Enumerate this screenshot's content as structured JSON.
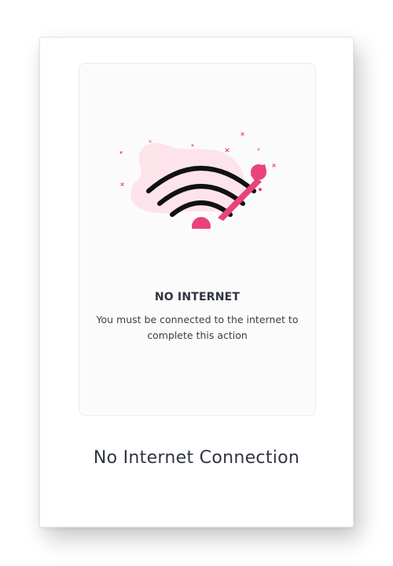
{
  "panel": {
    "heading": "NO INTERNET",
    "message": "You must be connected to the internet to complete this action"
  },
  "caption": "No Internet Connection",
  "illustration": {
    "icon": "wifi-off-icon",
    "colors": {
      "accent": "#e8437a",
      "blob": "#fde4ea",
      "arcs": "#111111"
    }
  }
}
